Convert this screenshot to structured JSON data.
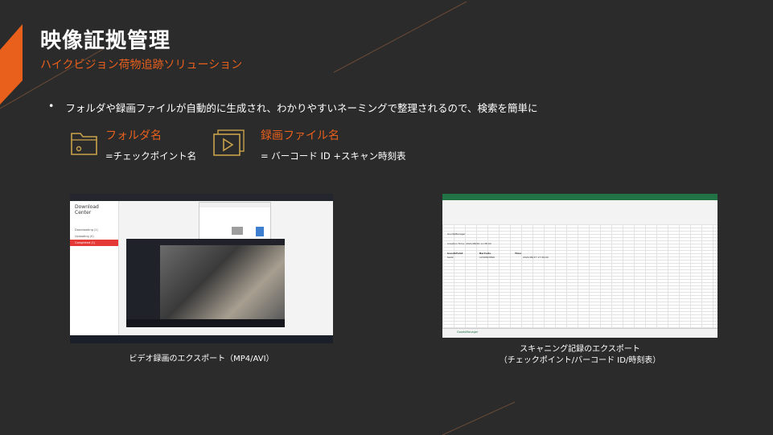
{
  "title": "映像証拠管理",
  "subtitle": "ハイクビジョン荷物追跡ソリューション",
  "bullet": {
    "marker": "•",
    "text": "フォルダや録画ファイルが自動的に生成され、わかりやすいネーミングで整理されるので、検索を簡単に"
  },
  "features": [
    {
      "icon": "folder-icon",
      "label": "フォルダ名",
      "desc": "=チェックポイント名"
    },
    {
      "icon": "video-file-icon",
      "label": "録画ファイル名",
      "desc": "= バーコード ID +スキャン時刻表"
    }
  ],
  "screenshots": {
    "left": {
      "window_title": "Download Center",
      "sidebar": [
        "Downloading (1)",
        "Uploading (0)",
        "Completed (1)"
      ],
      "caption": "ビデオ録画のエクスポート（MP4/AVI）"
    },
    "right": {
      "app": "Excel",
      "cells": [
        "GoodsManager",
        "Creation Time: 2021/08/26 11:38:03",
        "GoodsPoint",
        "BarCode",
        "Time",
        "test2",
        "1234567890",
        "2021/08/17 17:30:00"
      ],
      "sheet_tab": "GoodsManager",
      "caption_line1": "スキャニング記録のエクスポート",
      "caption_line2": "（チェックポイント/バーコード ID/時刻表）"
    }
  },
  "colors": {
    "background": "#2b2b2b",
    "accent": "#e8601c",
    "text": "#ffffff"
  }
}
